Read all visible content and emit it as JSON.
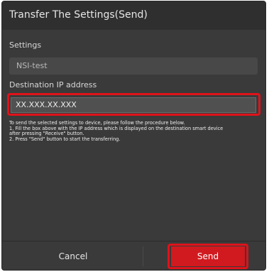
{
  "dialog": {
    "title": "Transfer The Settings(Send)"
  },
  "settings": {
    "label": "Settings",
    "value": "NSI-test"
  },
  "destination": {
    "label": "Destination IP address",
    "value": "XX.XXX.XX.XXX"
  },
  "instructions": [
    "To send the selected settings to device, please follow the procedure below.",
    "1. Fill the box above with the IP address which is displayed on the destination smart device",
    "after pressing \"Receive\" button.",
    "2. Press \"Send\" button to start the transferring."
  ],
  "buttons": {
    "cancel": "Cancel",
    "send": "Send"
  },
  "colors": {
    "highlight": "#e0121a",
    "send_bg": "#d11a1f",
    "dialog_bg": "#3a3a3a"
  }
}
